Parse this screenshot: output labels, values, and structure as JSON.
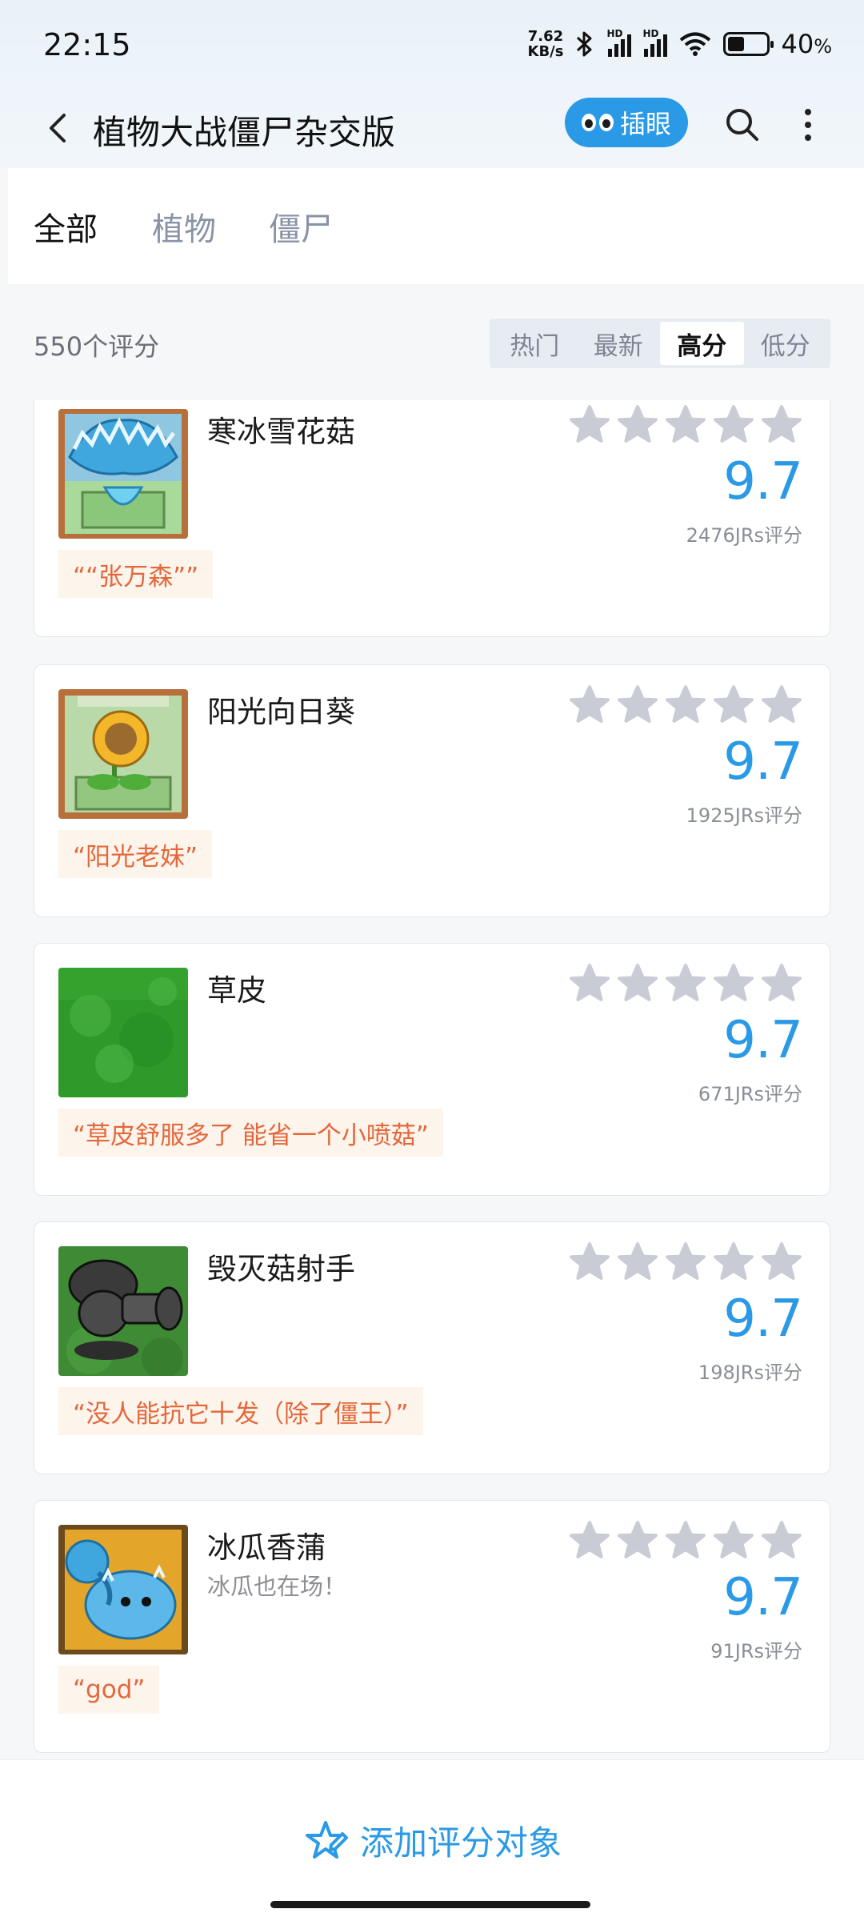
{
  "status_bar": {
    "time": "22:15",
    "net_speed_value": "7.62",
    "net_speed_unit": "KB/s",
    "battery_percent": "40",
    "battery_unit": "%",
    "signal_label": "HD"
  },
  "header": {
    "title": "植物大战僵尸杂交版",
    "peek_label": "插眼"
  },
  "tabs": [
    {
      "label": "全部",
      "active": true
    },
    {
      "label": "植物",
      "active": false
    },
    {
      "label": "僵尸",
      "active": false
    }
  ],
  "filter": {
    "count_label": "550个评分",
    "sort_options": [
      {
        "label": "热门",
        "active": false
      },
      {
        "label": "最新",
        "active": false
      },
      {
        "label": "高分",
        "active": true
      },
      {
        "label": "低分",
        "active": false
      }
    ]
  },
  "items": [
    {
      "name": "寒冰雪花菇",
      "desc": "",
      "score": "9.7",
      "votes": "2476JRs评分",
      "quote": "““张万森””",
      "icon": "snow-mushroom-card-image"
    },
    {
      "name": "阳光向日葵",
      "desc": "",
      "score": "9.7",
      "votes": "1925JRs评分",
      "quote": "“阳光老妹”",
      "icon": "sunflower-card-image"
    },
    {
      "name": "草皮",
      "desc": "",
      "score": "9.7",
      "votes": "671JRs评分",
      "quote": "“草皮舒服多了 能省一个小喷菇”",
      "icon": "grass-turf-image"
    },
    {
      "name": "毁灭菇射手",
      "desc": "",
      "score": "9.7",
      "votes": "198JRs评分",
      "quote": "“没人能抗它十发（除了僵王）”",
      "icon": "doom-shooter-image"
    },
    {
      "name": "冰瓜香蒲",
      "desc": "冰瓜也在场！",
      "score": "9.7",
      "votes": "91JRs评分",
      "quote": "“god”",
      "icon": "winter-melon-cattail-card-image"
    }
  ],
  "bottom": {
    "add_label": "添加评分对象"
  },
  "colors": {
    "accent": "#2b9ae6",
    "quote_text": "#e3683b",
    "quote_bg": "#fdf4ec",
    "star_gray": "#c9ccd4"
  }
}
